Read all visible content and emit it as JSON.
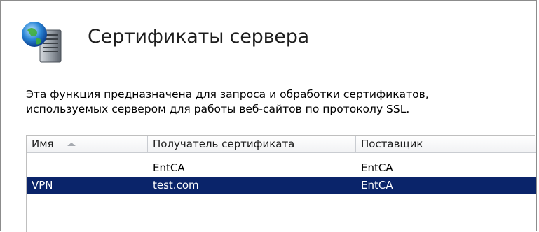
{
  "header": {
    "title": "Сертификаты сервера",
    "icon": "server-certificates-icon"
  },
  "description": {
    "line1": "Эта функция предназначена для запроса и обработки сертификатов,",
    "line2": "используемых сервером для работы веб-сайтов по протоколу SSL."
  },
  "table": {
    "columns": [
      "Имя",
      "Получатель сертификата",
      "Поставщик"
    ],
    "sort_column": "Имя",
    "sort_direction": "ascending",
    "rows": [
      {
        "name": "",
        "issued_to": "EntCA",
        "issued_by": "EntCA",
        "selected": false
      },
      {
        "name": "VPN",
        "issued_to": "test.com",
        "issued_by": "EntCA",
        "selected": true
      }
    ]
  },
  "colors": {
    "selection": "#0a246a",
    "header_bg": "#f1f2f4",
    "text": "#000000"
  }
}
